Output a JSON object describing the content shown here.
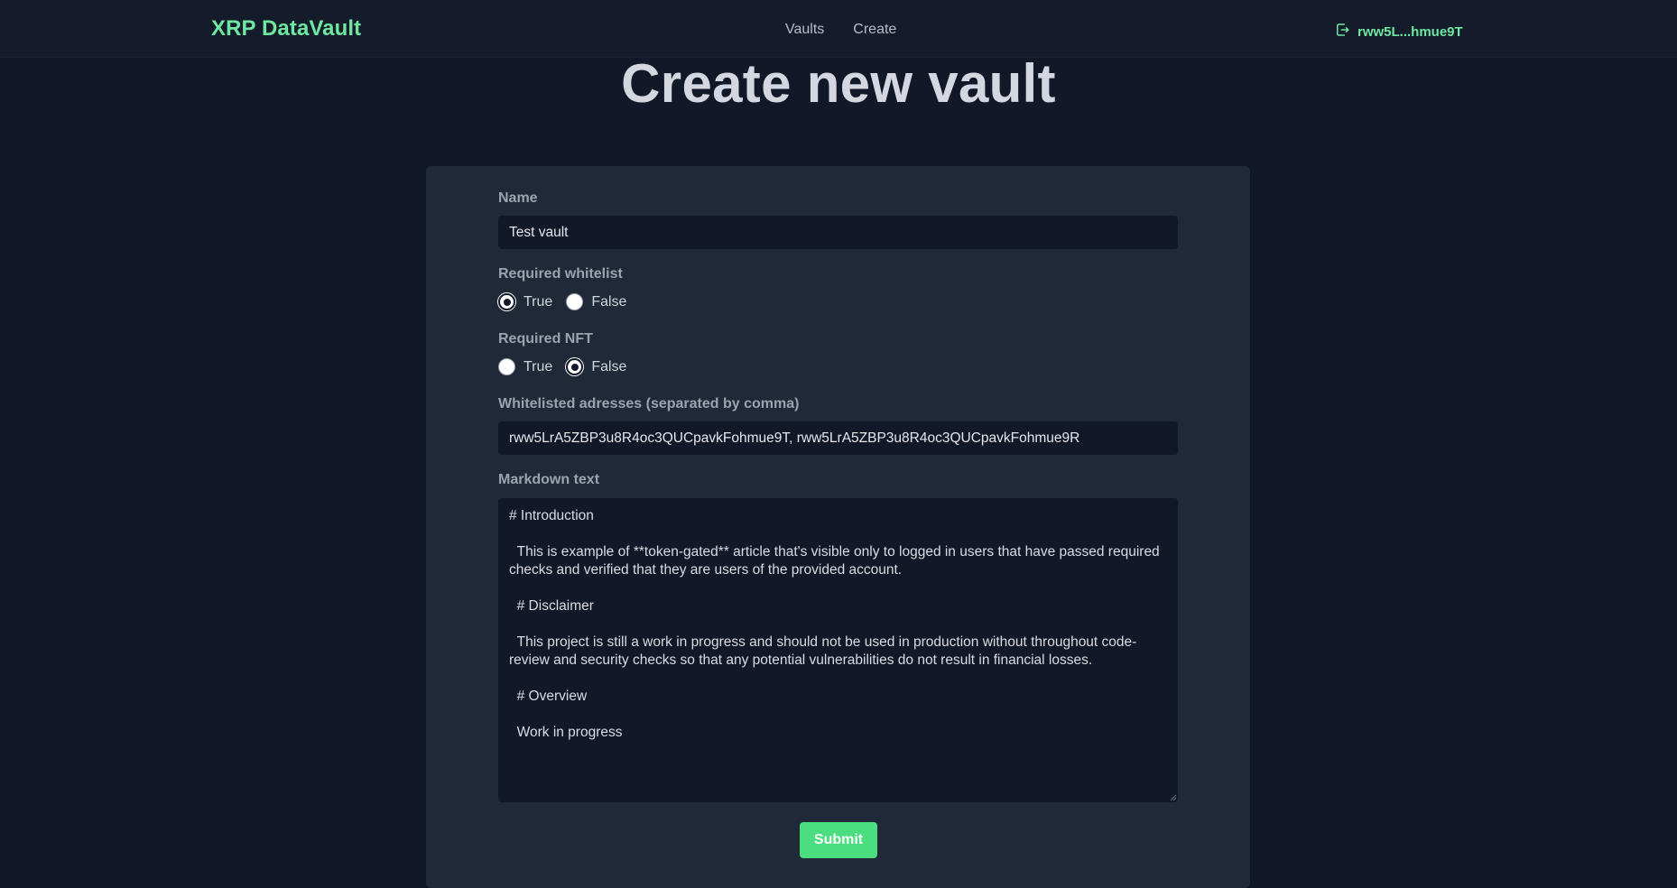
{
  "navbar": {
    "brand": "XRP DataVault",
    "links": [
      "Vaults",
      "Create"
    ],
    "account": "rww5L...hmue9T",
    "account_icon": "logout-icon",
    "brand_color": "#6ee7a0"
  },
  "page": {
    "title": "Create new vault"
  },
  "form": {
    "name": {
      "label": "Name",
      "value": "Test vault"
    },
    "required_whitelist": {
      "label": "Required whitelist",
      "options": [
        "True",
        "False"
      ],
      "selected": "True"
    },
    "required_nft": {
      "label": "Required NFT",
      "options": [
        "True",
        "False"
      ],
      "selected": "False"
    },
    "whitelisted": {
      "label": "Whitelisted adresses (separated by comma)",
      "value": "rww5LrA5ZBP3u8R4oc3QUCpavkFohmue9T, rww5LrA5ZBP3u8R4oc3QUCpavkFohmue9R"
    },
    "markdown": {
      "label": "Markdown text",
      "value": "# Introduction\n\n  This is example of **token-gated** article that's visible only to logged in users that have passed required checks and verified that they are users of the provided account.\n\n  # Disclaimer\n\n  This project is still a work in progress and should not be used in production without throughout code-review and security checks so that any potential vulnerabilities do not result in financial losses.\n\n  # Overview\n\n  Work in progress"
    },
    "submit_label": "Submit",
    "submit_color": "#4ade80"
  }
}
